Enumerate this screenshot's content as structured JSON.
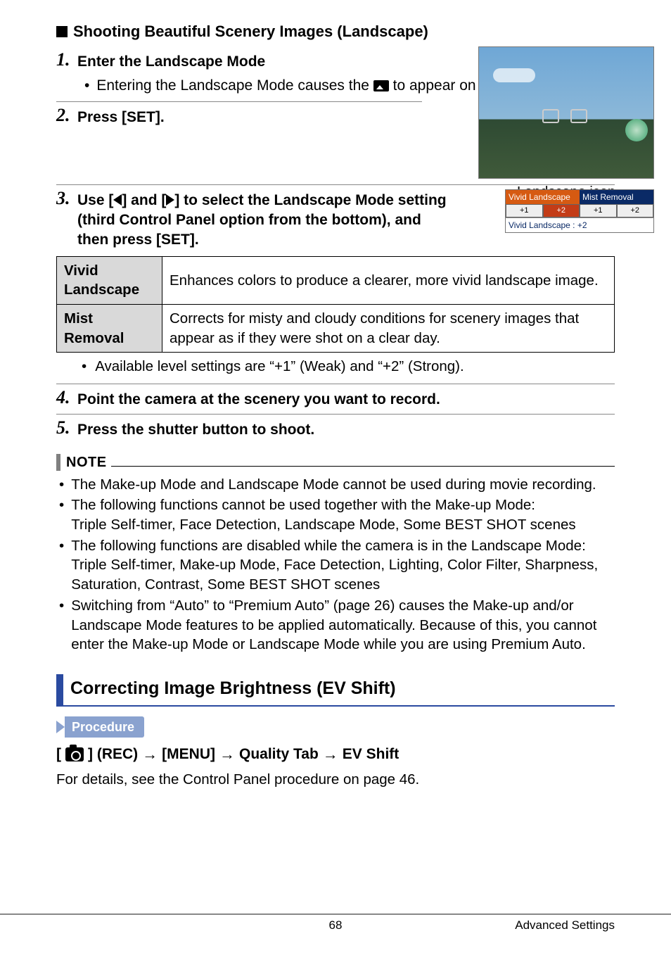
{
  "section_title": "Shooting Beautiful Scenery Images (Landscape)",
  "steps": {
    "s1": {
      "num": "1.",
      "title": "Enter the Landscape Mode",
      "bullet_pre": "Entering the Landscape Mode causes the",
      "bullet_post": "to appear on the Control Panel."
    },
    "s2": {
      "num": "2.",
      "title": "Press [SET]."
    },
    "s3": {
      "num": "3.",
      "title_pre": "Use [",
      "title_mid": "] and [",
      "title_post": "] to select the Landscape Mode setting (third Control Panel option from the bottom), and then press [SET]."
    },
    "s4": {
      "num": "4.",
      "title": "Point the camera at the scenery you want to record."
    },
    "s5": {
      "num": "5.",
      "title": "Press the shutter button to shoot."
    }
  },
  "thumb_caption": "Landscape icon",
  "mode_panel": {
    "tab1": "Vivid Landscape",
    "tab2": "Mist Removal",
    "lv1": "+1",
    "lv2": "+2",
    "lv3": "+1",
    "lv4": "+2",
    "status": "Vivid Landscape : +2"
  },
  "table": {
    "r1h": "Vivid Landscape",
    "r1d": "Enhances colors to produce a clearer, more vivid landscape image.",
    "r2h": "Mist Removal",
    "r2d": "Corrects for misty and cloudy conditions for scenery images that appear as if they were shot on a clear day."
  },
  "level_note": "Available level settings are “+1” (Weak) and “+2” (Strong).",
  "note_label": "NOTE",
  "notes": {
    "n1": "The Make-up Mode and Landscape Mode cannot be used during movie recording.",
    "n2a": "The following functions cannot be used together with the Make-up Mode:",
    "n2b": "Triple Self-timer, Face Detection, Landscape Mode, Some BEST SHOT scenes",
    "n3a": "The following functions are disabled while the camera is in the Landscape Mode:",
    "n3b": "Triple Self-timer, Make-up Mode, Face Detection, Lighting, Color Filter, Sharpness, Saturation, Contrast, Some BEST SHOT scenes",
    "n4": "Switching from “Auto” to “Premium Auto” (page 26) causes the Make-up and/or Landscape Mode features to be applied automatically. Because of this, you cannot enter the Make-up Mode or Landscape Mode while you are using Premium Auto."
  },
  "h2": "Correcting Image Brightness (EV Shift)",
  "procedure_label": "Procedure",
  "proc": {
    "open": "[",
    "rec": "] (REC)",
    "menu": "[MENU]",
    "qtab": "Quality Tab",
    "ev": "EV Shift",
    "arrow": "→"
  },
  "proc_text": "For details, see the Control Panel procedure on page 46.",
  "footer": {
    "page": "68",
    "section": "Advanced Settings"
  }
}
